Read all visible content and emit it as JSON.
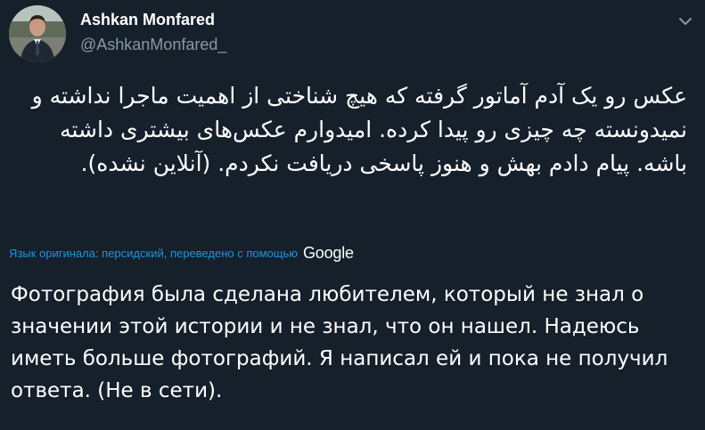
{
  "author": {
    "name": "Ashkan Monfared",
    "handle": "@AshkanMonfared_"
  },
  "tweet": {
    "original_text": "عکس رو یک آدم آماتور گرفته که هیچ شناختی از اهمیت ماجرا نداشته و نمیدونسته چه چیزی رو پیدا کرده. امیدوارم عکس‌های بیشتری داشته باشه. پیام دادم بهش و هنوز پاسخی دریافت نکردم. (آنلاین نشده).",
    "translation_note": "Язык оригинала: персидский, переведено с помощью",
    "translation_provider": "Google",
    "translated_text": "Фотография была сделана любителем, который не знал о значении этой истории и не знал, что он нашел. Надеюсь иметь больше фотографий. Я написал ей и пока не получил ответа. (Не в сети)."
  },
  "icons": {
    "menu": "chevron-down-icon",
    "avatar": "avatar-photo"
  },
  "colors": {
    "background": "#15202b",
    "text": "#ffffff",
    "secondary_text": "#8899a6",
    "link": "#1b95e0"
  }
}
